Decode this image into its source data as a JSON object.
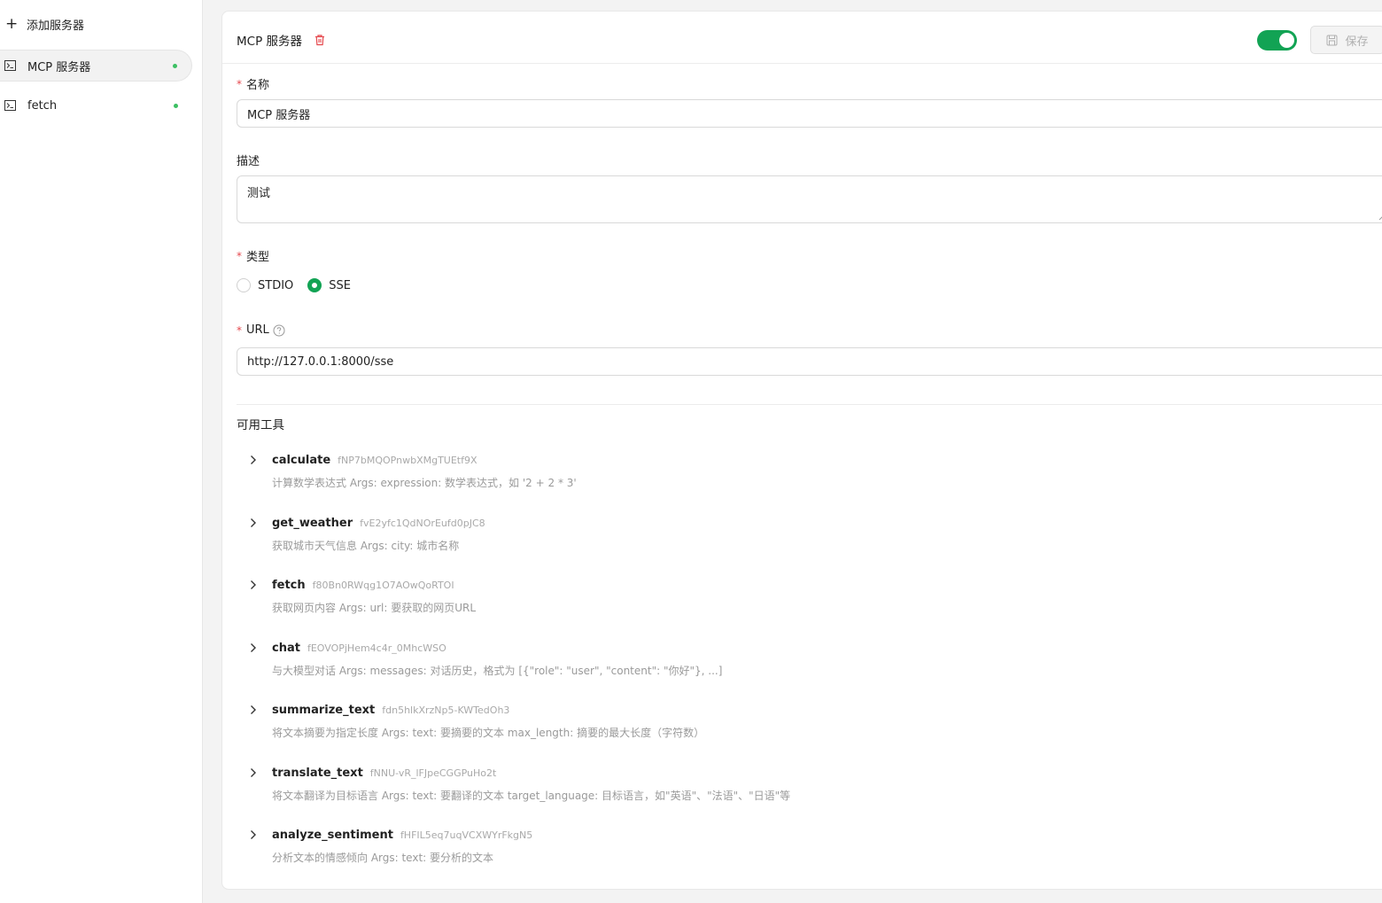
{
  "sidebar": {
    "add_label": "添加服务器",
    "servers": [
      {
        "label": "MCP 服务器",
        "status": "online"
      },
      {
        "label": "fetch",
        "status": "online"
      }
    ]
  },
  "header": {
    "title": "MCP 服务器",
    "save_label": "保存",
    "enabled": true
  },
  "form": {
    "name_label": "名称",
    "name_value": "MCP 服务器",
    "desc_label": "描述",
    "desc_value": "测试",
    "type_label": "类型",
    "type_options": [
      "STDIO",
      "SSE"
    ],
    "type_selected": "SSE",
    "url_label": "URL",
    "url_value": "http://127.0.0.1:8000/sse"
  },
  "tools": {
    "section_title": "可用工具",
    "items": [
      {
        "name": "calculate",
        "id": "fNP7bMQOPnwbXMgTUEtf9X",
        "desc": "计算数学表达式 Args: expression: 数学表达式，如 '2 + 2 * 3'"
      },
      {
        "name": "get_weather",
        "id": "fvE2yfc1QdNOrEufd0pJC8",
        "desc": "获取城市天气信息 Args: city: 城市名称"
      },
      {
        "name": "fetch",
        "id": "f80Bn0RWqg1O7AOwQoRTOI",
        "desc": "获取网页内容 Args: url: 要获取的网页URL"
      },
      {
        "name": "chat",
        "id": "fEOVOPjHem4c4r_0MhcWSO",
        "desc": "与大模型对话 Args: messages: 对话历史，格式为 [{\"role\": \"user\", \"content\": \"你好\"}, ...]"
      },
      {
        "name": "summarize_text",
        "id": "fdn5hlkXrzNp5-KWTedOh3",
        "desc": "将文本摘要为指定长度 Args: text: 要摘要的文本 max_length: 摘要的最大长度（字符数）"
      },
      {
        "name": "translate_text",
        "id": "fNNU-vR_lFJpeCGGPuHo2t",
        "desc": "将文本翻译为目标语言 Args: text: 要翻译的文本 target_language: 目标语言，如\"英语\"、\"法语\"、\"日语\"等"
      },
      {
        "name": "analyze_sentiment",
        "id": "fHFIL5eq7uqVCXWYrFkgN5",
        "desc": "分析文本的情感倾向 Args: text: 要分析的文本"
      }
    ]
  },
  "colors": {
    "accent": "#12a354",
    "status_online": "#3cc063",
    "danger": "#e5484d"
  },
  "icons": {
    "add": "plus-icon",
    "server": "terminal-icon",
    "delete": "trash-icon",
    "save": "floppy-icon",
    "help": "question-circle-icon",
    "expand": "chevron-right-icon"
  }
}
